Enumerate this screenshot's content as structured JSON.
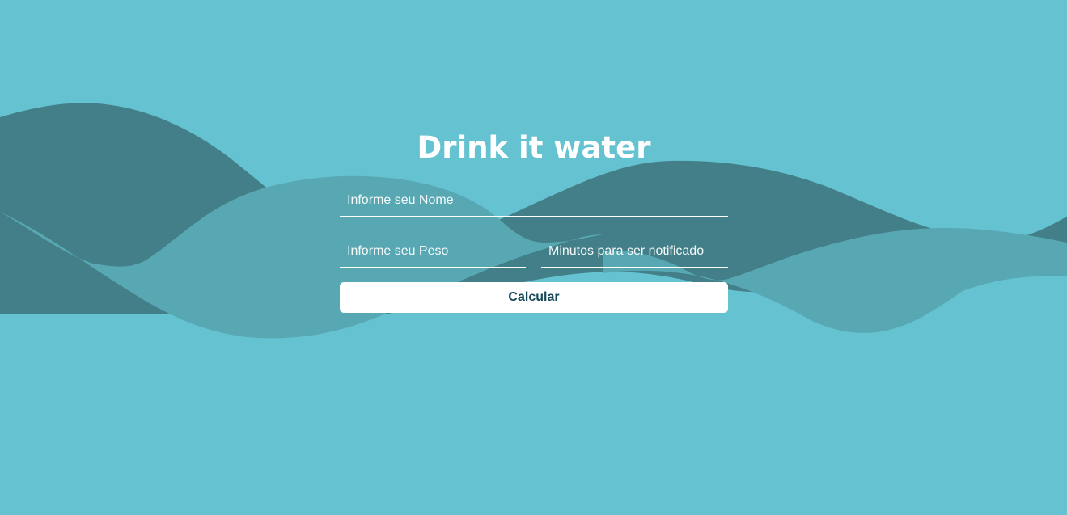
{
  "app": {
    "title": "Drink it water"
  },
  "form": {
    "name_placeholder": "Informe seu Nome",
    "weight_placeholder": "Informe seu Peso",
    "minutes_placeholder": "Minutos para ser notificado",
    "submit_label": "Calcular"
  },
  "colors": {
    "background": "#65c2d0",
    "wave_dark": "#437f88",
    "wave_mid": "#58a8b3",
    "button_text": "#16495a",
    "text": "#ffffff"
  }
}
